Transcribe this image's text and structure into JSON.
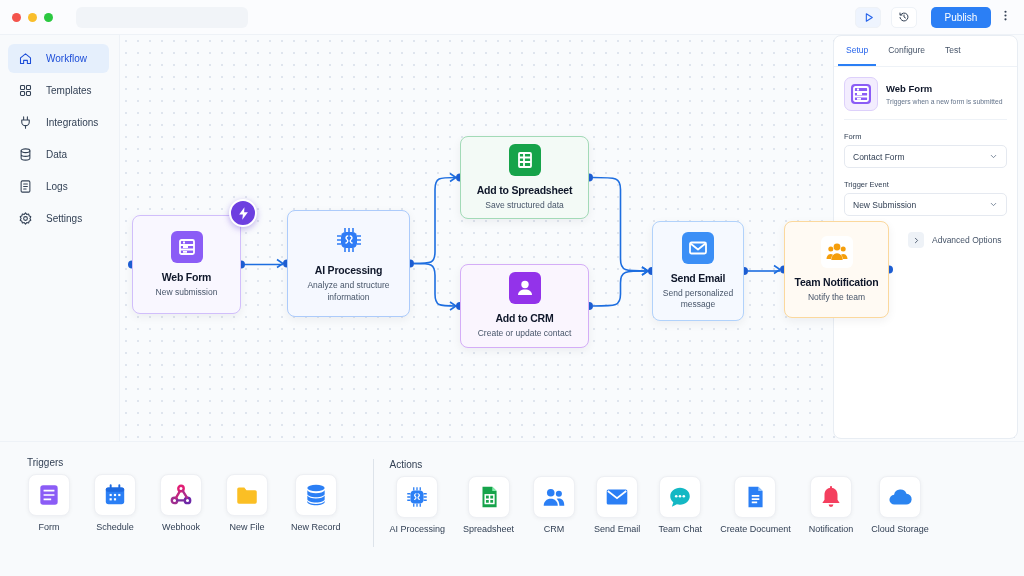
{
  "toolbar": {
    "publish": "Publish"
  },
  "sidebar": {
    "items": [
      {
        "label": "Workflow",
        "selected": true
      },
      {
        "label": "Templates",
        "selected": false
      },
      {
        "label": "Integrations",
        "selected": false
      },
      {
        "label": "Data",
        "selected": false
      },
      {
        "label": "Logs",
        "selected": false
      },
      {
        "label": "Settings",
        "selected": false
      }
    ]
  },
  "canvas": {
    "nodes": [
      {
        "title": "Web Form",
        "subtitle": "New submission",
        "color": "#8b5cf6",
        "trigger": true
      },
      {
        "title": "AI Processing",
        "subtitle": "Analyze and structure information",
        "color": "#2f7cf6",
        "trigger": false
      },
      {
        "title": "Add to Spreadsheet",
        "subtitle": "Save structured data",
        "color": "#16a34a",
        "trigger": false
      },
      {
        "title": "Add to CRM",
        "subtitle": "Create or update contact",
        "color": "#9333ea",
        "trigger": false
      },
      {
        "title": "Send Email",
        "subtitle": "Send personalized message",
        "color": "#3b8ff6",
        "trigger": false
      },
      {
        "title": "Team Notification",
        "subtitle": "Notify the team",
        "color": "#f59e0b",
        "trigger": false
      }
    ]
  },
  "panel": {
    "tabs": [
      {
        "label": "Setup",
        "selected": true
      },
      {
        "label": "Configure",
        "selected": false
      },
      {
        "label": "Test",
        "selected": false
      }
    ],
    "card": {
      "title": "Web Form",
      "description": "Triggers when a new form is submitted"
    },
    "fields": [
      {
        "label": "Form",
        "value": "Contact Form"
      },
      {
        "label": "Trigger Event",
        "value": "New Submission"
      }
    ],
    "advanced": {
      "label": "Advanced Options",
      "expanded": false
    }
  },
  "palette": {
    "triggers": {
      "title": "Triggers",
      "items": [
        "Form",
        "Schedule",
        "Webhook",
        "New File",
        "New Record"
      ]
    },
    "actions": {
      "title": "Actions",
      "items": [
        "AI Processing",
        "Spreadsheet",
        "CRM",
        "Send Email",
        "Team Chat",
        "Create Document",
        "Notification",
        "Cloud Storage"
      ]
    }
  }
}
